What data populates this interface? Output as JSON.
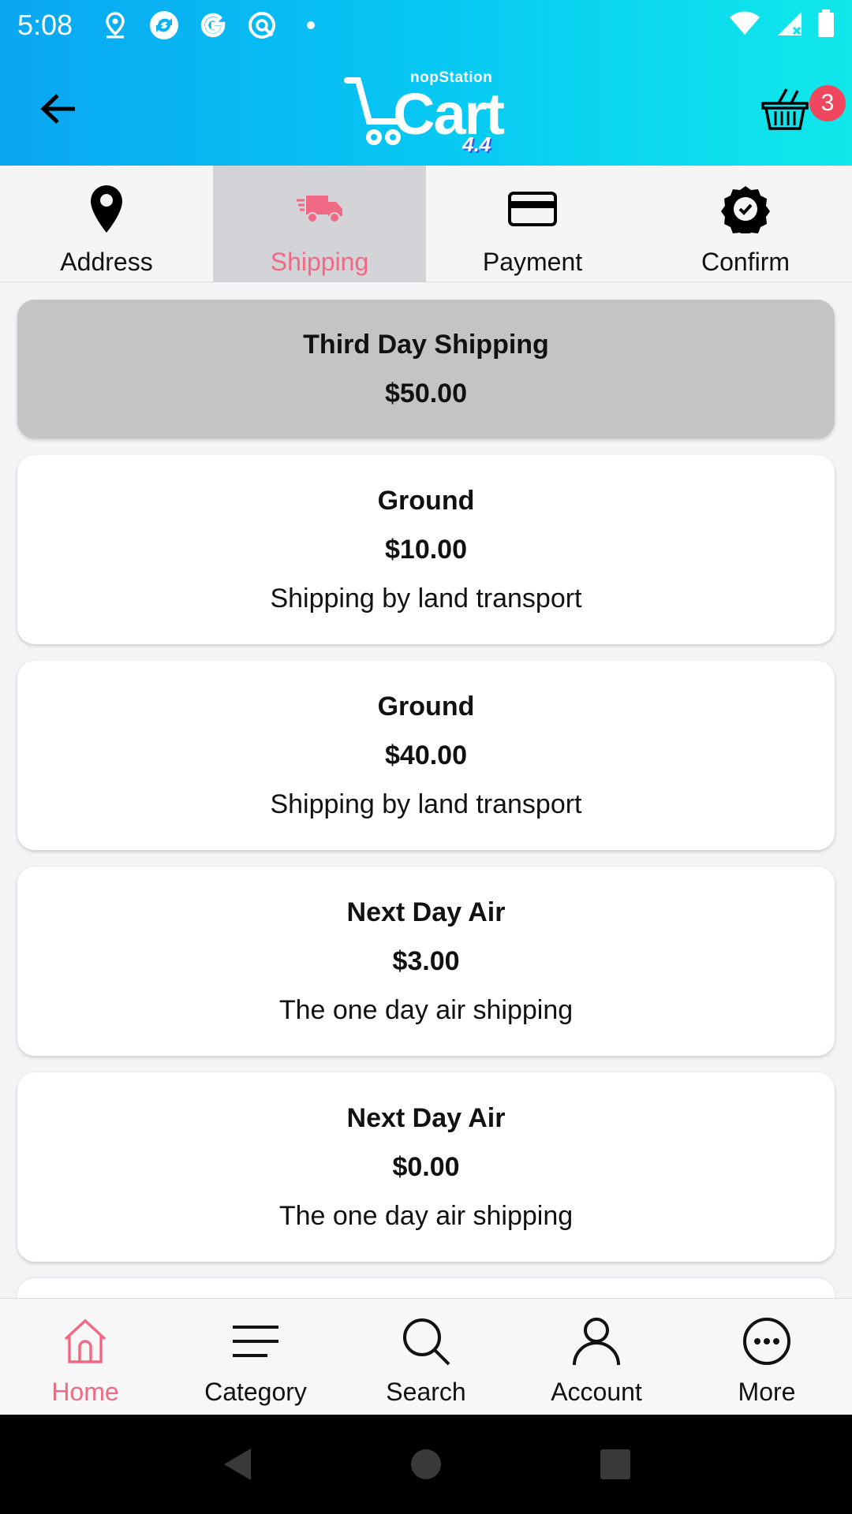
{
  "status_bar": {
    "time": "5:08",
    "icons_left": [
      "location-icon",
      "sync-icon",
      "google-icon",
      "assistant-icon",
      "dot-icon"
    ],
    "icons_right": [
      "wifi-icon",
      "signal-icon",
      "battery-icon"
    ]
  },
  "app_bar": {
    "logo_brand": "nopStation",
    "logo_word": "Cart",
    "logo_version": "4.4",
    "cart_count": "3"
  },
  "steps": [
    {
      "label": "Address",
      "icon": "map-pin-icon",
      "active": false
    },
    {
      "label": "Shipping",
      "icon": "truck-icon",
      "active": true
    },
    {
      "label": "Payment",
      "icon": "credit-card-icon",
      "active": false
    },
    {
      "label": "Confirm",
      "icon": "check-badge-icon",
      "active": false
    }
  ],
  "shipping_options": [
    {
      "name": "Third Day Shipping",
      "price": "$50.00",
      "description": "",
      "selected": true
    },
    {
      "name": "Ground",
      "price": "$10.00",
      "description": "Shipping by land transport",
      "selected": false
    },
    {
      "name": "Ground",
      "price": "$40.00",
      "description": "Shipping by land transport",
      "selected": false
    },
    {
      "name": "Next Day Air",
      "price": "$3.00",
      "description": "The one day air shipping",
      "selected": false
    },
    {
      "name": "Next Day Air",
      "price": "$0.00",
      "description": "The one day air shipping",
      "selected": false
    }
  ],
  "bottom_nav": [
    {
      "label": "Home",
      "icon": "home-icon",
      "active": true
    },
    {
      "label": "Category",
      "icon": "menu-icon",
      "active": false
    },
    {
      "label": "Search",
      "icon": "search-icon",
      "active": false
    },
    {
      "label": "Account",
      "icon": "user-icon",
      "active": false
    },
    {
      "label": "More",
      "icon": "more-icon",
      "active": false
    }
  ],
  "colors": {
    "accent": "#f06a85",
    "header_start": "#0aa6f2",
    "header_end": "#10e8ea",
    "badge": "#f0475f",
    "selected_option": "#c4c4c4",
    "active_step": "#d3d3d8"
  }
}
